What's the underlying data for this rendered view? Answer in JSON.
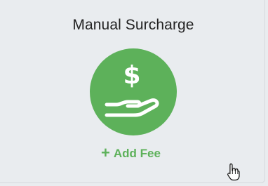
{
  "card": {
    "title": "Manual Surcharge",
    "icon": "hand-dollar-icon",
    "add_fee_icon": "plus-icon",
    "add_fee_label": "Add Fee"
  },
  "colors": {
    "accent": "#5db15a",
    "background": "#e9ecef",
    "title_text": "#222222"
  },
  "cursor": "hand-pointer-cursor"
}
